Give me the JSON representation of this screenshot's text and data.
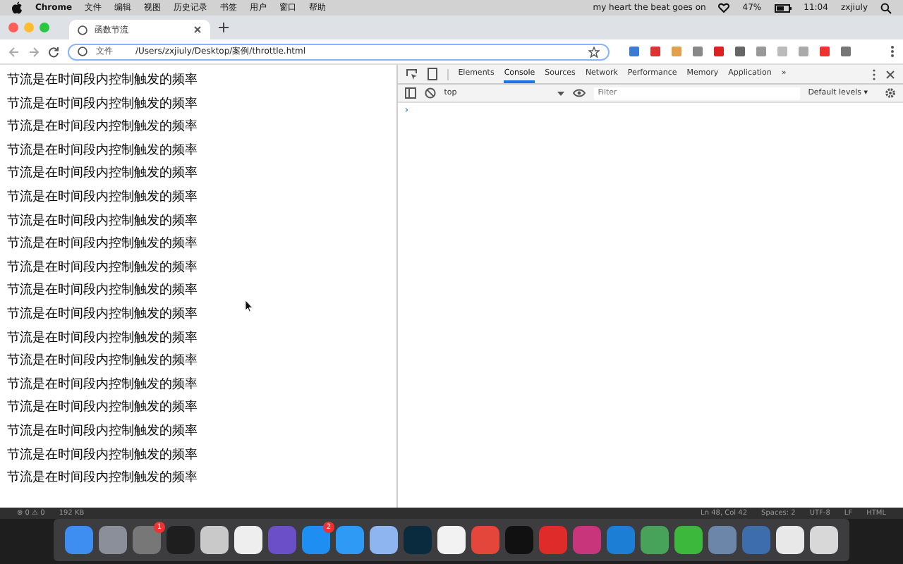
{
  "menu_bar": {
    "app": "Chrome",
    "items": [
      "文件",
      "编辑",
      "视图",
      "历史记录",
      "书签",
      "用户",
      "窗口",
      "帮助"
    ],
    "now_playing": "my heart the beat goes on",
    "battery": "47%",
    "time": "11:04",
    "user": "zxjiuly"
  },
  "tabs": [
    {
      "title": "函数节流",
      "selected": true
    }
  ],
  "address_bar": {
    "scheme_label": "文件",
    "url": "/Users/zxjiuly/Desktop/案例/throttle.html"
  },
  "page": {
    "lines": [
      "节流是在时间段内控制触发的频率",
      "节流是在时间段内控制触发的频率",
      "节流是在时间段内控制触发的频率",
      "节流是在时间段内控制触发的频率",
      "节流是在时间段内控制触发的频率",
      "节流是在时间段内控制触发的频率",
      "节流是在时间段内控制触发的频率",
      "节流是在时间段内控制触发的频率",
      "节流是在时间段内控制触发的频率",
      "节流是在时间段内控制触发的频率",
      "节流是在时间段内控制触发的频率",
      "节流是在时间段内控制触发的频率",
      "节流是在时间段内控制触发的频率",
      "节流是在时间段内控制触发的频率",
      "节流是在时间段内控制触发的频率",
      "节流是在时间段内控制触发的频率",
      "节流是在时间段内控制触发的频率",
      "节流是在时间段内控制触发的频率"
    ]
  },
  "devtools": {
    "tabs": [
      {
        "label": "Elements",
        "selected": false
      },
      {
        "label": "Console",
        "selected": true
      },
      {
        "label": "Sources",
        "selected": false
      },
      {
        "label": "Network",
        "selected": false
      },
      {
        "label": "Performance",
        "selected": false
      },
      {
        "label": "Memory",
        "selected": false
      },
      {
        "label": "Application",
        "selected": false
      }
    ],
    "more": "»",
    "context": "top",
    "filter_placeholder": "Filter",
    "levels": "Default levels ▾",
    "prompt": "›"
  },
  "status_bar": {
    "left": [
      "⊗ 0 ⚠ 0",
      "192 KB"
    ],
    "right": [
      "Ln 48, Col 42",
      "Spaces: 2",
      "UTF-8",
      "LF",
      "HTML"
    ]
  },
  "dock": [
    {
      "color": "#3d8ef0"
    },
    {
      "color": "#8a8f99"
    },
    {
      "color": "#777777",
      "badge": "1"
    },
    {
      "color": "#1e1e1e"
    },
    {
      "color": "#c9c9c9"
    },
    {
      "color": "#eeeeee"
    },
    {
      "color": "#6b4fc9"
    },
    {
      "color": "#1e8ef2",
      "badge": "2"
    },
    {
      "color": "#2f9af5"
    },
    {
      "color": "#8fb5f0"
    },
    {
      "color": "#0a2a3e"
    },
    {
      "color": "#f2f2f2"
    },
    {
      "color": "#e4463b"
    },
    {
      "color": "#111111"
    },
    {
      "color": "#e02b2b"
    },
    {
      "color": "#c8357a"
    },
    {
      "color": "#1d7ed6"
    },
    {
      "color": "#48a35a"
    },
    {
      "color": "#3cb93c"
    },
    {
      "color": "#6b86a8"
    },
    {
      "color": "#3d6dad"
    },
    {
      "color": "#e8e8e8"
    },
    {
      "color": "#d8d8d8"
    }
  ]
}
